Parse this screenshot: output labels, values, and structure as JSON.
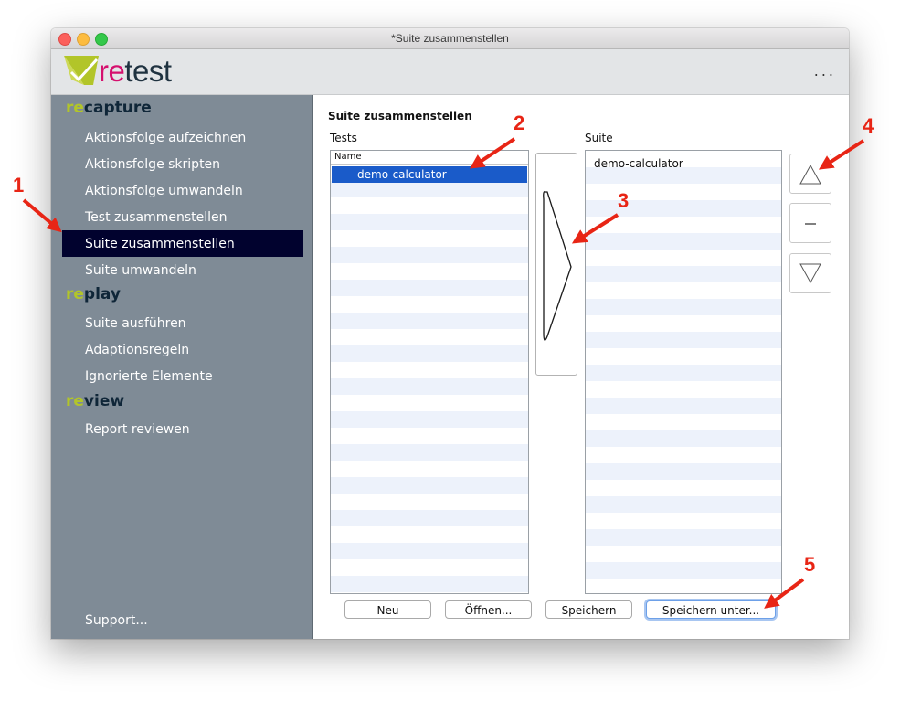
{
  "window": {
    "title": "*Suite zusammenstellen"
  },
  "brand": {
    "logo_prefix": "re",
    "logo_suffix": "test",
    "more_label": "..."
  },
  "sidebar": {
    "sections": [
      {
        "prefix": "re",
        "suffix": "capture",
        "items": [
          "Aktionsfolge aufzeichnen",
          "Aktionsfolge skripten",
          "Aktionsfolge umwandeln",
          "Test zusammenstellen",
          "Suite zusammenstellen",
          "Suite umwandeln"
        ]
      },
      {
        "prefix": "re",
        "suffix": "play",
        "items": [
          "Suite ausführen",
          "Adaptionsregeln",
          "Ignorierte Elemente"
        ]
      },
      {
        "prefix": "re",
        "suffix": "view",
        "items": [
          "Report reviewen"
        ]
      }
    ],
    "active_item": "Suite zusammenstellen",
    "support": "Support..."
  },
  "main": {
    "title": "Suite zusammenstellen",
    "tests_label": "Tests",
    "suite_label": "Suite",
    "tests_column_header": "Name",
    "tests_items": [
      "demo-calculator"
    ],
    "suite_items": [
      "demo-calculator"
    ]
  },
  "buttons": {
    "neu": "Neu",
    "oeffnen": "Öffnen...",
    "speichern": "Speichern",
    "speichern_unter": "Speichern unter..."
  },
  "side_buttons": {
    "move_up": "up-triangle-icon",
    "remove": "minus-icon",
    "move_down": "down-triangle-icon"
  },
  "annotations": [
    "1",
    "2",
    "3",
    "4",
    "5"
  ],
  "colors": {
    "sidebar_bg": "#7f8b96",
    "active_item": "#01022e",
    "selection": "#1a5bc9",
    "accent_green": "#b2c529",
    "logo_pink": "#d5106e",
    "annotation_red": "#e82515"
  }
}
